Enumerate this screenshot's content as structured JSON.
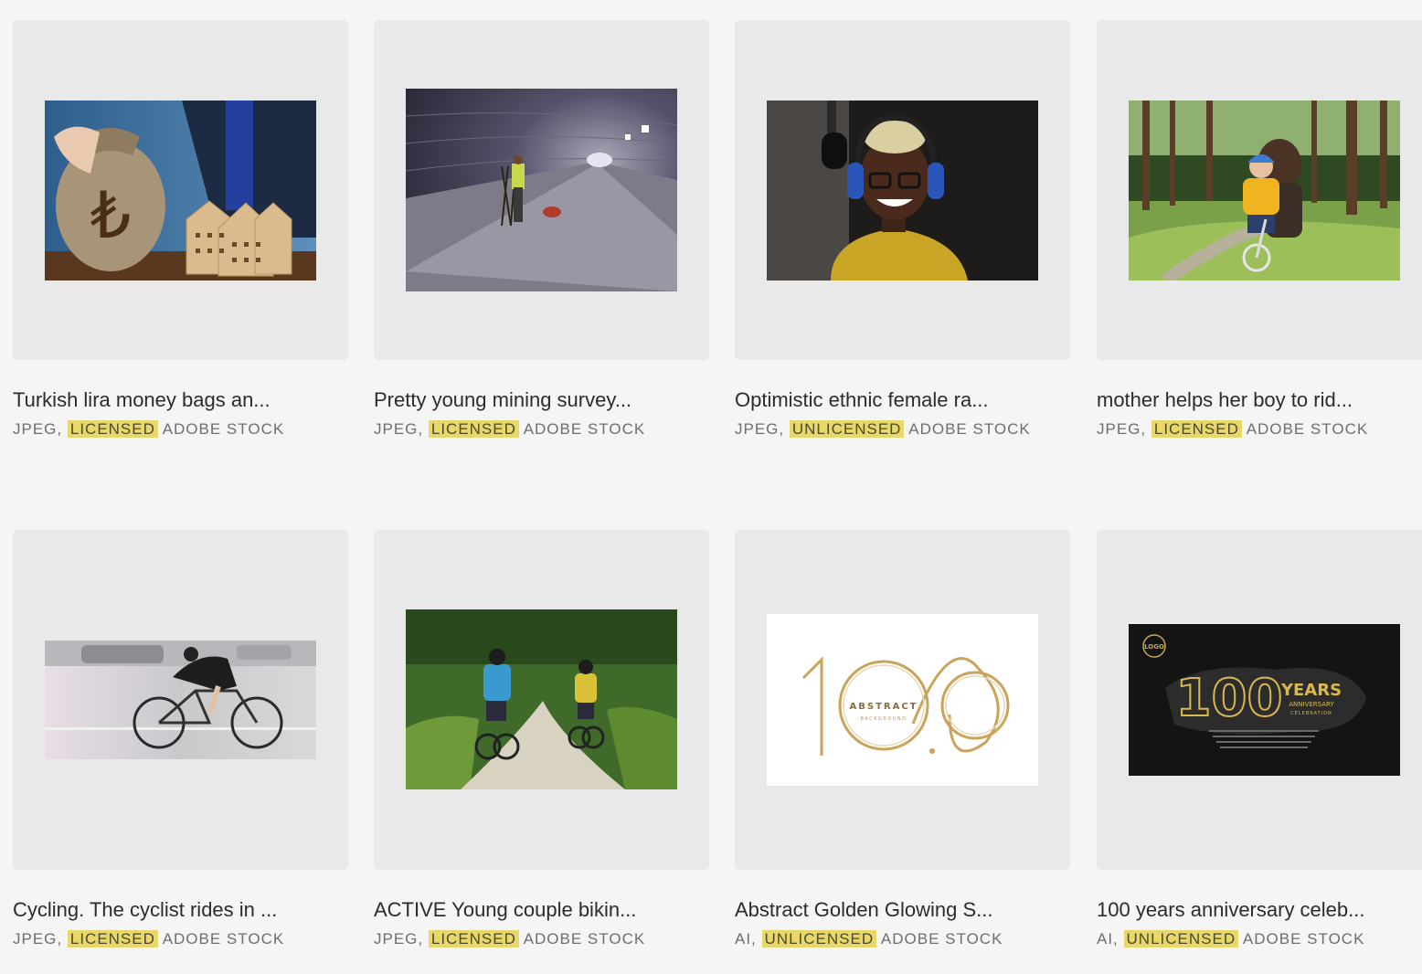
{
  "assets": [
    {
      "title": "Turkish lira money bags an...",
      "format": "JPEG,",
      "license": "LICENSED",
      "source": "ADOBE STOCK",
      "icon": "money-bag-houses-thumbnail"
    },
    {
      "title": "Pretty young mining survey...",
      "format": "JPEG,",
      "license": "LICENSED",
      "source": "ADOBE STOCK",
      "icon": "tunnel-thumbnail"
    },
    {
      "title": "Optimistic ethnic female ra...",
      "format": "JPEG,",
      "license": "UNLICENSED",
      "source": "ADOBE STOCK",
      "icon": "woman-headphones-thumbnail"
    },
    {
      "title": "mother helps her boy to rid...",
      "format": "JPEG,",
      "license": "LICENSED",
      "source": "ADOBE STOCK",
      "icon": "park-bicycle-thumbnail"
    },
    {
      "title": "Cycling. The cyclist rides in ...",
      "format": "JPEG,",
      "license": "LICENSED",
      "source": "ADOBE STOCK",
      "icon": "road-cyclist-thumbnail"
    },
    {
      "title": "ACTIVE Young couple bikin...",
      "format": "JPEG,",
      "license": "LICENSED",
      "source": "ADOBE STOCK",
      "icon": "forest-bikers-thumbnail"
    },
    {
      "title": "Abstract Golden Glowing S...",
      "format": "AI,",
      "license": "UNLICENSED",
      "source": "ADOBE STOCK",
      "icon": "golden-100-thumbnail"
    },
    {
      "title": "100 years anniversary celeb...",
      "format": "AI,",
      "license": "UNLICENSED",
      "source": "ADOBE STOCK",
      "icon": "anniversary-badge-thumbnail"
    }
  ],
  "thumb_text": {
    "abstract": "ABSTRACT",
    "background": "BACKGROUND",
    "logo": "LOGO",
    "hundred": "100",
    "years": "YEARS",
    "anniversary": "ANNIVERSARY",
    "celebration": "CELEBRATION"
  },
  "colors": {
    "highlight": "#e8d86c",
    "card_bg": "#e9e9e9",
    "page_bg": "#f5f5f5"
  }
}
